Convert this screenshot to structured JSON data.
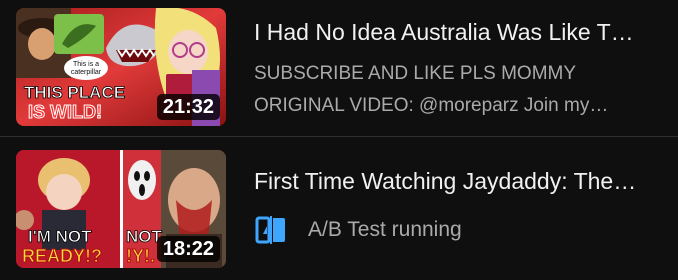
{
  "videos": [
    {
      "title": "I Had No Idea Australia Was Like T…",
      "description_lines": [
        "SUBSCRIBE AND LIKE PLS MOMMY",
        "ORIGINAL VIDEO: @moreparz Join my…"
      ],
      "duration": "21:32",
      "thumbnail_text": {
        "line1": "THIS PLACE",
        "line2": "IS WILD!",
        "caption_line1": "This is a",
        "caption_line2": "caterpillar"
      }
    },
    {
      "title": "First Time Watching Jaydaddy: The…",
      "status": {
        "icon": "ab-test-icon",
        "label": "A/B Test running"
      },
      "duration": "18:22",
      "thumbnail_text": {
        "line1": "I'M NOT",
        "line2": "READY!?",
        "line1b": "NOT",
        "line2b": "!Y!."
      }
    }
  ],
  "colors": {
    "background": "#0f0f0f",
    "title": "#f1f1f1",
    "secondary": "#aaaaaa",
    "ab_icon": "#3ea6ff",
    "thumb_red": "#d81c1c"
  }
}
